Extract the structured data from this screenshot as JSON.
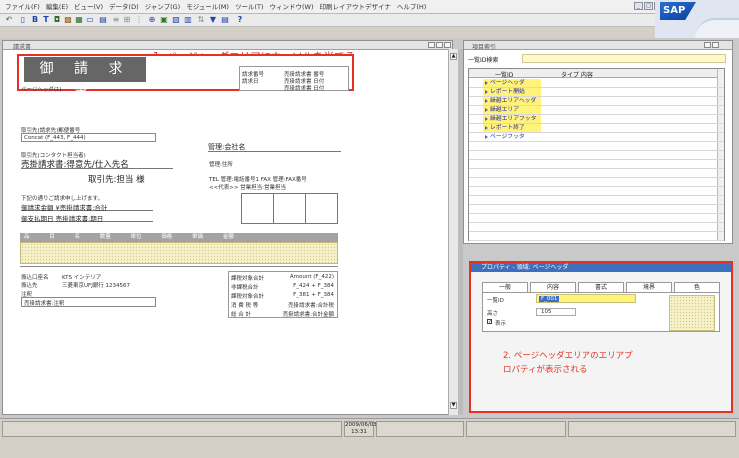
{
  "menubar": {
    "items": [
      "ファイル(F)",
      "編集(E)",
      "ビュー(V)",
      "データ(D)",
      "ジャンプ(G)",
      "モジュール(M)",
      "ツール(T)",
      "ウィンドウ(W)",
      "印刷レイアウトデザイナ",
      "ヘルプ(H)"
    ]
  },
  "brand": {
    "logo": "SAP",
    "accent": "#2a6fd1"
  },
  "doc_window": {
    "title": "請求書",
    "callout1": "1. ページヘッダエリアにカーソルを当てる",
    "title_block": "御 請 求 書",
    "header_left_caption": "ページヘッダ(1)",
    "doc_fields": {
      "row1_label": "請求番号",
      "row1_value": "売掛請求書 番号",
      "row2_label": "請求日",
      "row2_value": "売掛請求書 日付",
      "row3_value": "売掛請求書 日付"
    },
    "customer": {
      "line1": "取引先(請求先)郵便番号",
      "line2": "Concat (F_443, F_444)",
      "line3": "取引先(コンタクト担当者)",
      "name": "売掛請求書:得意先/仕入先名",
      "honorific": "取引先:担当 様"
    },
    "company": {
      "name": "管理:会社名",
      "address": "管理:住所",
      "tel": "TEL 管理:電話番号1 FAX 管理:FAX番号",
      "rep": "<<代表>> 営業担当:営業担当"
    },
    "intro": "下記の通りご請求申し上げます。",
    "amount_line": "御請求金額 ¥売掛請求書:合計",
    "due_line": "御支払期日 売掛請求書:期日",
    "table_header": "品 目 名 数量 単位 価格 単価 金額",
    "bank": {
      "label": "振込口座名",
      "value1": "KTS インテリア",
      "label2": "振込先",
      "value2": "三菱東京UFJ銀行 1234567",
      "label3": "注釈",
      "value3": "売掛請求書:注釈"
    },
    "totals": {
      "rows": [
        {
          "label": "課税対象合計",
          "value": "Amount (F_422)"
        },
        {
          "label": "非課税合計",
          "value": "F_424 + F_384"
        },
        {
          "label": "課税対象合計",
          "value": "F_381 + F_384"
        },
        {
          "label": "消 費 税 等",
          "value": "売掛請求書:合計税"
        },
        {
          "label": "総 合 計",
          "value": "売掛請求書:合計金額"
        }
      ]
    }
  },
  "right_panel": {
    "title": "項目索引",
    "search_label": "一覧ID検索",
    "col_id": "一覧ID",
    "col_type": "タイプ 内容",
    "items": [
      {
        "label": "ページヘッダ",
        "highlighted": true
      },
      {
        "label": "レポート開始",
        "highlighted": true
      },
      {
        "label": "繰越エリアヘッダ",
        "highlighted": true
      },
      {
        "label": "繰越エリア",
        "highlighted": true
      },
      {
        "label": "繰越エリアフッタ",
        "highlighted": true
      },
      {
        "label": "レポート終了",
        "highlighted": true
      },
      {
        "label": "ページフッタ",
        "highlighted": false
      }
    ]
  },
  "prop_panel": {
    "title": "プロパティ - 領域: ページヘッダ",
    "tabs": [
      "一般",
      "内容",
      "書式",
      "境界",
      "色"
    ],
    "field_id_label": "一覧ID",
    "field_id_value": "F_001",
    "height_label": "高さ",
    "height_value": "105",
    "show_label": "表示",
    "callout2_line1": "2. ページヘッダエリアのエリアプ",
    "callout2_line2": "ロパティが表示される"
  },
  "status": {
    "date": "2009/06/03",
    "time": "13:31"
  },
  "colors": {
    "callout_red": "#e53024",
    "highlight_yellow": "#fff37a",
    "title_blue": "#3d6fbd"
  }
}
